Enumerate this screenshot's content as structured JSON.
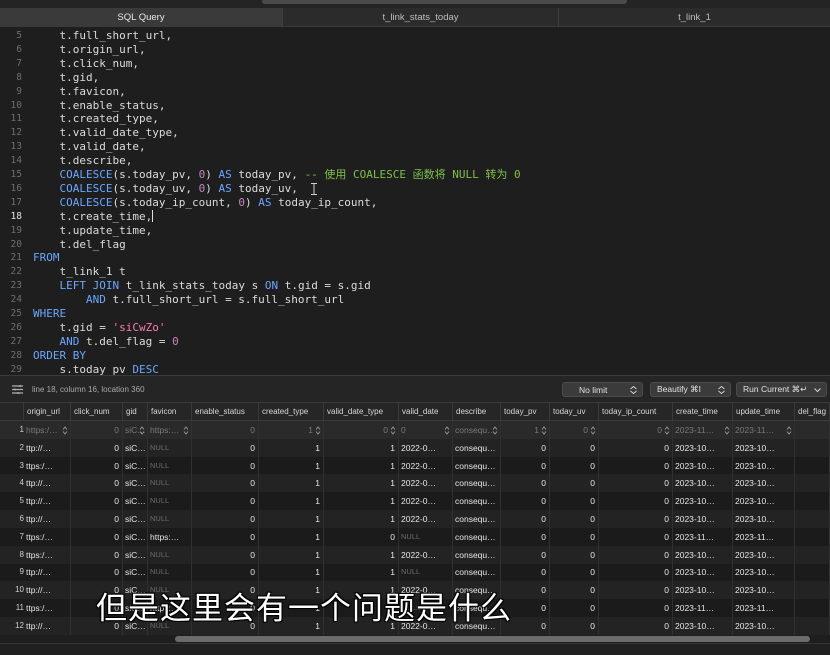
{
  "tabs": [
    {
      "label": "SQL Query",
      "active": true
    },
    {
      "label": "t_link_stats_today",
      "active": false
    },
    {
      "label": "t_link_1",
      "active": false
    }
  ],
  "editor": {
    "current_line": 18,
    "lines": [
      {
        "n": 5,
        "text": "    t.full_short_url,"
      },
      {
        "n": 6,
        "text": "    t.origin_url,"
      },
      {
        "n": 7,
        "text": "    t.click_num,"
      },
      {
        "n": 8,
        "text": "    t.gid,"
      },
      {
        "n": 9,
        "text": "    t.favicon,"
      },
      {
        "n": 10,
        "text": "    t.enable_status,"
      },
      {
        "n": 11,
        "text": "    t.created_type,"
      },
      {
        "n": 12,
        "text": "    t.valid_date_type,"
      },
      {
        "n": 13,
        "text": "    t.valid_date,"
      },
      {
        "n": 14,
        "text": "    t.describe,"
      },
      {
        "n": 15,
        "text": "    COALESCE(s.today_pv, 0) AS today_pv, -- 使用 COALESCE 函数将 NULL 转为 0"
      },
      {
        "n": 16,
        "text": "    COALESCE(s.today_uv, 0) AS today_uv,"
      },
      {
        "n": 17,
        "text": "    COALESCE(s.today_ip_count, 0) AS today_ip_count,"
      },
      {
        "n": 18,
        "text": "    t.create_time,"
      },
      {
        "n": 19,
        "text": "    t.update_time,"
      },
      {
        "n": 20,
        "text": "    t.del_flag"
      },
      {
        "n": 21,
        "text": "FROM"
      },
      {
        "n": 22,
        "text": "    t_link_1 t"
      },
      {
        "n": 23,
        "text": "    LEFT JOIN t_link_stats_today s ON t.gid = s.gid"
      },
      {
        "n": 24,
        "text": "        AND t.full_short_url = s.full_short_url"
      },
      {
        "n": 25,
        "text": "WHERE"
      },
      {
        "n": 26,
        "text": "    t.gid = 'siCwZo'"
      },
      {
        "n": 27,
        "text": "    AND t.del_flag = 0"
      },
      {
        "n": 28,
        "text": "ORDER BY"
      },
      {
        "n": 29,
        "text": "    s.today_pv DESC"
      }
    ]
  },
  "statusbar": {
    "location": "line 18, column 16, location 360",
    "limit_label": "No limit",
    "beautify_label": "Beautify ⌘I",
    "run_label": "Run Current ⌘↵"
  },
  "grid": {
    "columns": [
      "origin_url",
      "click_num",
      "gid",
      "favicon",
      "enable_status",
      "created_type",
      "valid_date_type",
      "valid_date",
      "describe",
      "today_pv",
      "today_uv",
      "today_ip_count",
      "create_time",
      "update_time",
      "del_flag"
    ],
    "rows": [
      [
        "https:/…",
        "0",
        "siC…",
        "https:…",
        "0",
        "1",
        "0",
        "0",
        "consequ…",
        "1",
        "0",
        "0",
        "2023-11…",
        "2023-11…",
        ""
      ],
      [
        "ttp://…",
        "0",
        "siC…",
        "NULL",
        "0",
        "1",
        "1",
        "2022-0…",
        "consequ…",
        "0",
        "0",
        "0",
        "2023-10…",
        "2023-10…",
        ""
      ],
      [
        "ttps:/…",
        "0",
        "siC…",
        "NULL",
        "0",
        "1",
        "1",
        "2022-0…",
        "consequ…",
        "0",
        "0",
        "0",
        "2023-10…",
        "2023-10…",
        ""
      ],
      [
        "ttp://…",
        "0",
        "siC…",
        "NULL",
        "0",
        "1",
        "1",
        "2022-0…",
        "consequ…",
        "0",
        "0",
        "0",
        "2023-10…",
        "2023-10…",
        ""
      ],
      [
        "ttp://…",
        "0",
        "siC…",
        "NULL",
        "0",
        "1",
        "1",
        "2022-0…",
        "consequ…",
        "0",
        "0",
        "0",
        "2023-10…",
        "2023-10…",
        ""
      ],
      [
        "ttp://…",
        "0",
        "siC…",
        "NULL",
        "0",
        "1",
        "1",
        "2022-0…",
        "consequ…",
        "0",
        "0",
        "0",
        "2023-10…",
        "2023-10…",
        ""
      ],
      [
        "ttps:/…",
        "0",
        "siC…",
        "https:…",
        "0",
        "1",
        "0",
        "NULL",
        "consequ…",
        "0",
        "0",
        "0",
        "2023-11…",
        "2023-11…",
        ""
      ],
      [
        "ttps:/…",
        "0",
        "siC…",
        "NULL",
        "0",
        "1",
        "1",
        "2022-0…",
        "consequ…",
        "0",
        "0",
        "0",
        "2023-10…",
        "2023-10…",
        ""
      ],
      [
        "ttp://…",
        "0",
        "siC…",
        "NULL",
        "0",
        "1",
        "1",
        "NULL",
        "consequ…",
        "0",
        "0",
        "0",
        "2023-10…",
        "2023-10…",
        ""
      ],
      [
        "ttp://…",
        "0",
        "siC…",
        "NULL",
        "0",
        "1",
        "1",
        "2022-0…",
        "consequ…",
        "0",
        "0",
        "0",
        "2023-10…",
        "2023-10…",
        ""
      ],
      [
        "ttps:/…",
        "0",
        "siC…",
        "https:…",
        "0",
        "1",
        "0",
        "NULL",
        "consequ…",
        "0",
        "0",
        "0",
        "2023-11…",
        "2023-11…",
        ""
      ],
      [
        "ttp://…",
        "0",
        "siC…",
        "NULL",
        "0",
        "1",
        "1",
        "2022-0…",
        "consequ…",
        "0",
        "0",
        "0",
        "2023-10…",
        "2023-10…",
        ""
      ]
    ]
  },
  "subtitle": "但是这里会有一个问题是什么",
  "colors": {
    "keyword": "#6aa7ff",
    "number": "#c586c0",
    "string": "#ff7ab2",
    "comment": "#7ec04a"
  },
  "icons": [
    "lines-icon",
    "chevron-updown-icon",
    "text-cursor-icon",
    "stepper-icon"
  ]
}
